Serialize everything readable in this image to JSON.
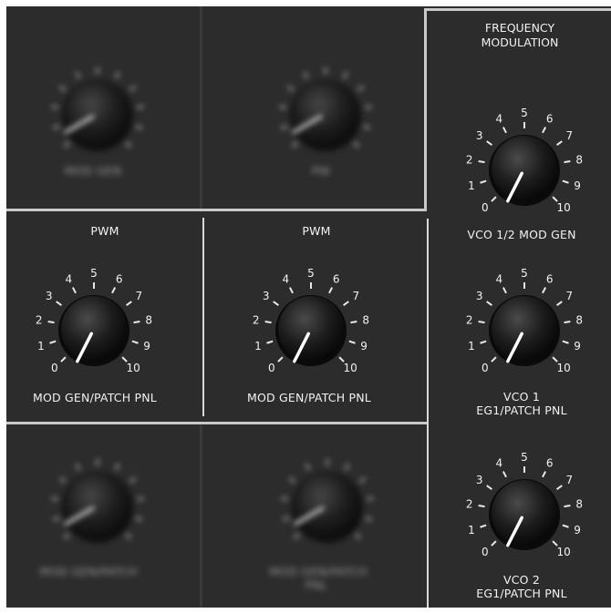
{
  "panel": {
    "frequency_modulation": {
      "title_line1": "FREQUENCY",
      "title_line2": "MODULATION"
    },
    "pwm_left": {
      "title": "PWM",
      "label": "MOD GEN/PATCH PNL"
    },
    "pwm_right": {
      "title": "PWM",
      "label": "MOD GEN/PATCH PNL"
    },
    "vco12": {
      "label": "VCO 1/2 MOD GEN"
    },
    "vco1": {
      "label_line1": "VCO 1",
      "label_line2": "EG1/PATCH PNL"
    },
    "vco2": {
      "label_line1": "VCO 2",
      "label_line2": "EG1/PATCH PNL"
    },
    "scale": [
      "0",
      "1",
      "2",
      "3",
      "4",
      "5",
      "6",
      "7",
      "8",
      "9",
      "10"
    ],
    "blurred_labels": {
      "top_left": "MOD GEN",
      "top_right": "PW",
      "bottom_left": "MOD GEN/PATCH",
      "bottom_right_1": "MOD GEN/PATCH",
      "bottom_right_2": "PNL"
    }
  },
  "colors": {
    "panel_bg": "#2c2c2c",
    "knob": "#151515",
    "pointer": "#ffffff",
    "text": "#f2f2f2",
    "divider": "#c9c9c9"
  },
  "knob_values": {
    "pwm_left": 0.5,
    "pwm_right": 0.5,
    "vco12": 0.5,
    "vco1": 0.5,
    "vco2": 0.5
  }
}
